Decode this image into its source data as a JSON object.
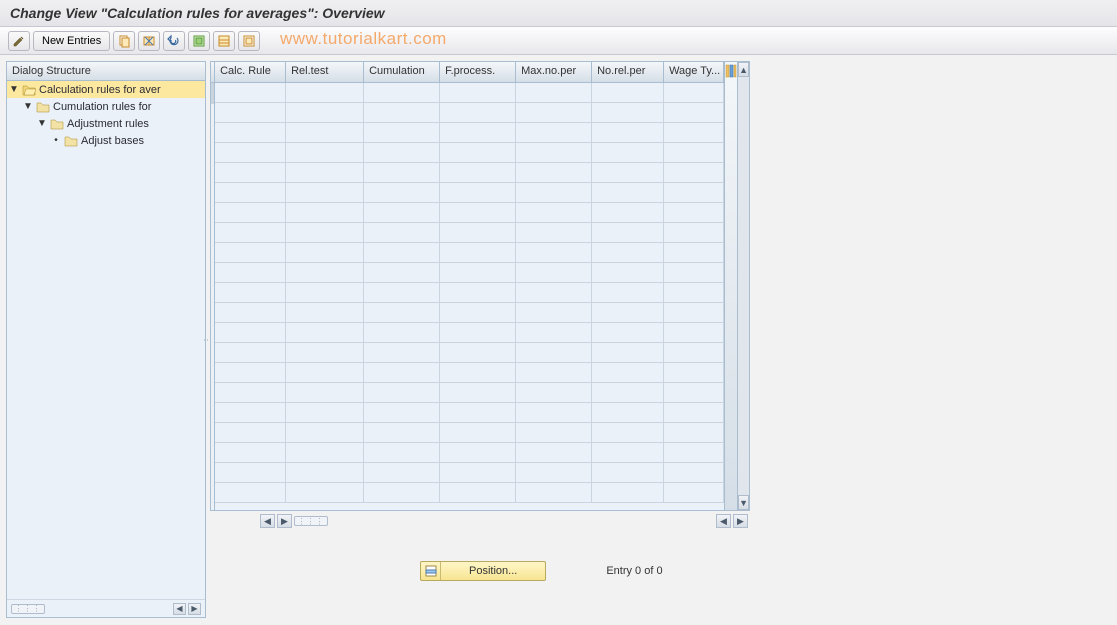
{
  "title": "Change View \"Calculation rules for averages\": Overview",
  "watermark": "www.tutorialkart.com",
  "toolbar": {
    "new_entries_label": "New Entries"
  },
  "tree": {
    "header": "Dialog Structure",
    "items": [
      {
        "label": "Calculation rules for aver",
        "indent": 0,
        "open": true,
        "selected": true,
        "expander": "▼"
      },
      {
        "label": "Cumulation rules for ",
        "indent": 1,
        "open": false,
        "selected": false,
        "expander": "▼"
      },
      {
        "label": "Adjustment rules",
        "indent": 2,
        "open": false,
        "selected": false,
        "expander": "▼"
      },
      {
        "label": "Adjust bases",
        "indent": 3,
        "open": false,
        "selected": false,
        "expander": "•"
      }
    ]
  },
  "table": {
    "columns": [
      "Calc. Rule",
      "Rel.test",
      "Cumulation",
      "F.process.",
      "Max.no.per",
      "No.rel.per",
      "Wage Ty..."
    ],
    "row_count": 21
  },
  "footer": {
    "position_label": "Position...",
    "entry_text": "Entry 0 of 0"
  }
}
